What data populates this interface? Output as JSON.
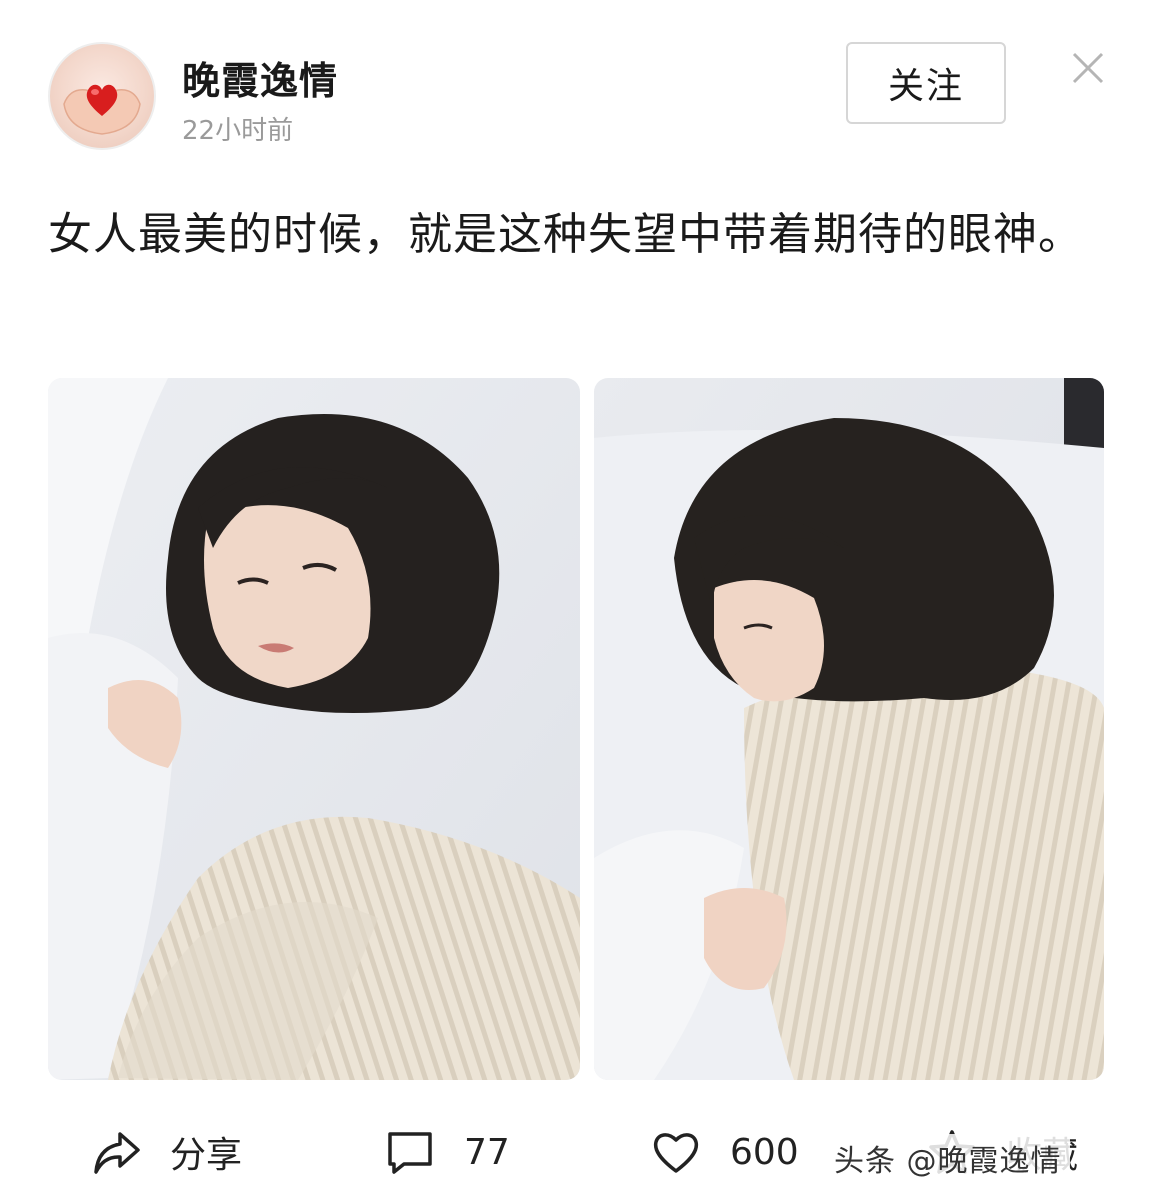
{
  "author": {
    "name": "晚霞逸情",
    "time": "22小时前",
    "avatar_icon": "heart-in-hands-icon"
  },
  "header": {
    "follow_label": "关注",
    "close_icon": "close-icon"
  },
  "post": {
    "text": "女人最美的时候，就是这种失望中带着期待的眼神。"
  },
  "images": [
    {
      "name": "photo-woman-looking-back"
    },
    {
      "name": "photo-woman-looking-down"
    }
  ],
  "actions": {
    "share": {
      "label": "分享",
      "icon": "share-arrow-icon"
    },
    "comment": {
      "count": "77",
      "icon": "comment-bubble-icon"
    },
    "like": {
      "count": "600",
      "icon": "heart-outline-icon"
    },
    "favorite": {
      "label": "收藏",
      "icon": "star-icon"
    }
  },
  "watermark": "头条 @晚霞逸情",
  "colors": {
    "text": "#1a1a1a",
    "muted": "#9a9a9a",
    "border": "#d6d6d6"
  }
}
